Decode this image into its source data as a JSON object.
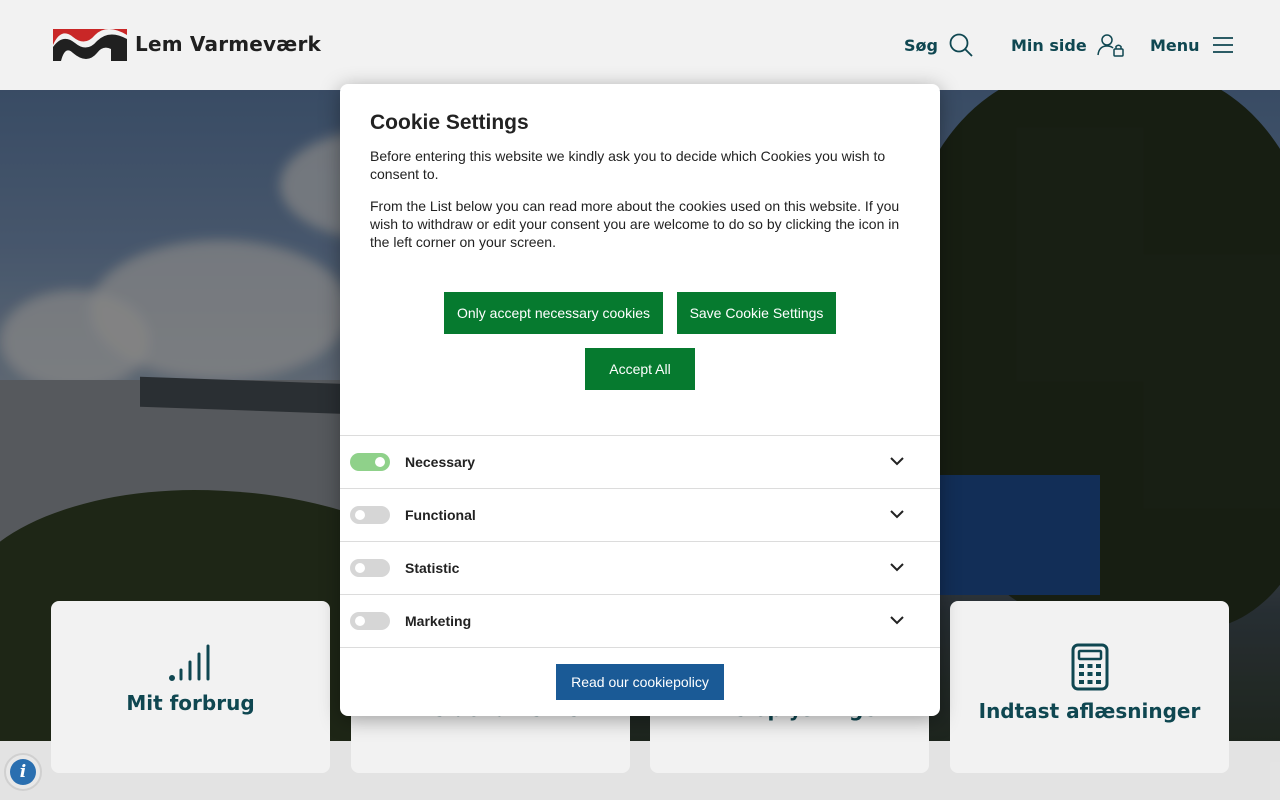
{
  "header": {
    "brand": "Lem Varmeværk",
    "search_label": "Søg",
    "mypage_label": "Min side",
    "menu_label": "Menu"
  },
  "cards": [
    {
      "label": "Mit forbrug",
      "icon": "signal-bars-icon"
    },
    {
      "label": "Mine dokumenter",
      "icon": "documents-icon"
    },
    {
      "label": "Mine oplysninger",
      "icon": "user-info-icon"
    },
    {
      "label": "Indtast aflæsninger",
      "icon": "calculator-icon"
    }
  ],
  "cookie_modal": {
    "title": "Cookie Settings",
    "paragraph1": "Before entering this website we kindly ask you to decide which Cookies you wish to consent to.",
    "paragraph2": "From the List below you can read more about the cookies used on this website. If you wish to withdraw or edit your consent you are welcome to do so by clicking the icon in the left corner on your screen.",
    "btn_necessary": "Only accept necessary cookies",
    "btn_save": "Save Cookie Settings",
    "btn_accept_all": "Accept All",
    "categories": [
      {
        "label": "Necessary",
        "enabled": true
      },
      {
        "label": "Functional",
        "enabled": false
      },
      {
        "label": "Statistic",
        "enabled": false
      },
      {
        "label": "Marketing",
        "enabled": false
      }
    ],
    "btn_policy": "Read our cookiepolicy"
  },
  "colors": {
    "brand_teal": "#104b56",
    "accept_green": "#067a2f",
    "policy_blue": "#1a5a96",
    "toggle_on": "#8fd18a",
    "logo_red": "#d42a2a"
  }
}
